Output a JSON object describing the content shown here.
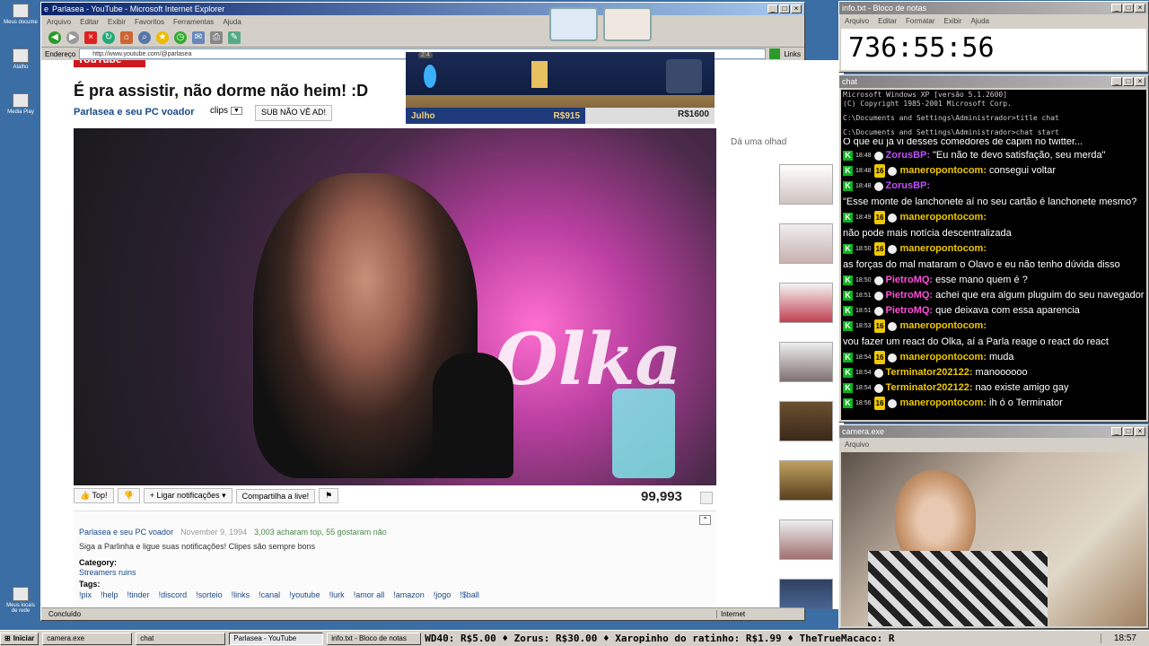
{
  "desktop": {
    "icons": [
      "Meus docume",
      "Atalho",
      "Media Play",
      "Meus locais de rede"
    ]
  },
  "ie": {
    "title": "Parlasea - YouTube - Microsoft Internet Explorer",
    "menu": [
      "Arquivo",
      "Editar",
      "Exibir",
      "Favoritos",
      "Ferramentas",
      "Ajuda"
    ],
    "address_label": "Endereço",
    "address": "http://www.youtube.com/@parlasea",
    "links": "Links",
    "status_left": "Concluído",
    "status_right": "Internet"
  },
  "video": {
    "logo": "YouTube",
    "title": "É pra assistir, não dorme não heim! :D",
    "channel": "Parlasea e seu PC voador",
    "clips": "clips",
    "sub_button": "SUB NÃO VÊ AD!",
    "top": "Top!",
    "notify": "Ligar notificações",
    "share": "Compartilha a live!",
    "views": "99,993",
    "side_label": "Dá uma olhad",
    "overlay_text": "Olka"
  },
  "description": {
    "channel": "Parlasea e seu PC voador",
    "date": "November 9, 1994",
    "likes": "3,003 acharam top, 55 gostaram não",
    "text": "Siga a Parlinha e ligue suas notificações! Clipes são sempre bons",
    "category_label": "Category:",
    "category": "Streamers ruins",
    "tags_label": "Tags:",
    "tags": [
      "!pix",
      "!help",
      "!tinder",
      "!discord",
      "!sorteio",
      "!links",
      "!canal",
      "!youtube",
      "!lurk",
      "!amor all",
      "!amazon",
      "!jogo",
      "!$ball"
    ]
  },
  "game": {
    "counter": "2:4",
    "month": "Julho",
    "amount1": "R$915",
    "amount2": "R$1600"
  },
  "notepad": {
    "title": "info.txt - Bloco de notas",
    "menu": [
      "Arquivo",
      "Editar",
      "Formatar",
      "Exibir",
      "Ajuda"
    ],
    "content": "736:55:56"
  },
  "chat": {
    "title": "chat",
    "console": [
      "Microsoft Windows XP [versão 5.1.2600]",
      "(C) Copyright 1985-2001 Microsoft Corp.",
      "C:\\Documents and Settings\\Administrador>title chat",
      "C:\\Documents and Settings\\Administrador>chat start"
    ],
    "partial": "O que eu já vi desses comedores de capim no twitter...",
    "messages": [
      {
        "time": "18:48",
        "badge": "",
        "user": "ZorusBP:",
        "color": "#c050ff",
        "text": "\"Eu não te devo satisfação, seu merda\""
      },
      {
        "time": "18:48",
        "badge": "16",
        "user": "maneropontocom:",
        "color": "#f0c800",
        "text": "consegui voltar"
      },
      {
        "time": "18:48",
        "badge": "",
        "user": "ZorusBP:",
        "color": "#c050ff",
        "text": "\"Esse monte de lanchonete aí no seu cartão é lanchonete mesmo?"
      },
      {
        "time": "18:49",
        "badge": "16",
        "user": "maneropontocom:",
        "color": "#f0c800",
        "text": "não pode mais notícia descentralizada"
      },
      {
        "time": "18:50",
        "badge": "16",
        "user": "maneropontocom:",
        "color": "#f0c800",
        "text": "as forças do mal mataram o Olavo e eu não tenho dúvida disso"
      },
      {
        "time": "18:50",
        "badge": "",
        "user": "PietroMQ:",
        "color": "#ff50d8",
        "text": "esse mano quem é ?"
      },
      {
        "time": "18:51",
        "badge": "",
        "user": "PietroMQ:",
        "color": "#ff50d8",
        "text": "achei que era algum pluguim do seu navegador"
      },
      {
        "time": "18:51",
        "badge": "",
        "user": "PietroMQ:",
        "color": "#ff50d8",
        "text": "que deixava com essa aparencia"
      },
      {
        "time": "18:53",
        "badge": "16",
        "user": "maneropontocom:",
        "color": "#f0c800",
        "text": "vou fazer um react do Olka, aí a Parla reage o react do react"
      },
      {
        "time": "18:54",
        "badge": "16",
        "user": "maneropontocom:",
        "color": "#f0c800",
        "text": "muda"
      },
      {
        "time": "18:54",
        "badge": "",
        "user": "Terminator202122:",
        "color": "#f0c800",
        "text": "manoooooo"
      },
      {
        "time": "18:54",
        "badge": "",
        "user": "Terminator202122:",
        "color": "#f0c800",
        "text": "nao existe amigo gay"
      },
      {
        "time": "18:56",
        "badge": "16",
        "user": "maneropontocom:",
        "color": "#f0c800",
        "text": "ih ó o Terminator"
      }
    ]
  },
  "camera": {
    "title": "camera.exe",
    "menu": "Arquivo"
  },
  "taskbar": {
    "start": "Iniciar",
    "tasks": [
      "camera.exe",
      "chat",
      "Parlasea - YouTube",
      "info.txt - Bloco de notas"
    ],
    "ticker": "WD40: R$5.00  ♦  Zorus: R$30.00  ♦  Xaropinho do ratinho: R$1.99  ♦  TheTrueMacaco: R",
    "clock": "18:57"
  }
}
